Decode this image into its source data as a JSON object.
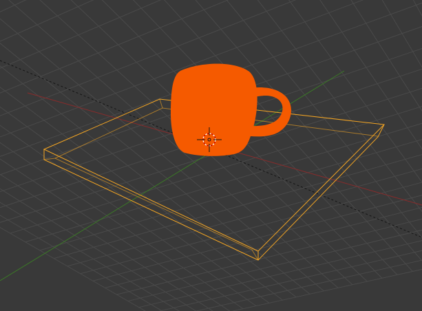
{
  "viewport": {
    "background": "#393939",
    "grid_color": "#4a4a4a",
    "x_axis_color": "#8a2b2b",
    "y_axis_color": "#3b7a26",
    "view_line_color": "#141414",
    "selection_outline_color": "#f5a623",
    "mug_color": "#f55a00",
    "cursor_color_light": "#ffffff",
    "cursor_color_dark": "#c00000"
  },
  "objects": [
    {
      "name": "Cup",
      "selected": true
    },
    {
      "name": "Box",
      "selected": true
    }
  ],
  "icons": [
    "3d-cursor-icon"
  ]
}
